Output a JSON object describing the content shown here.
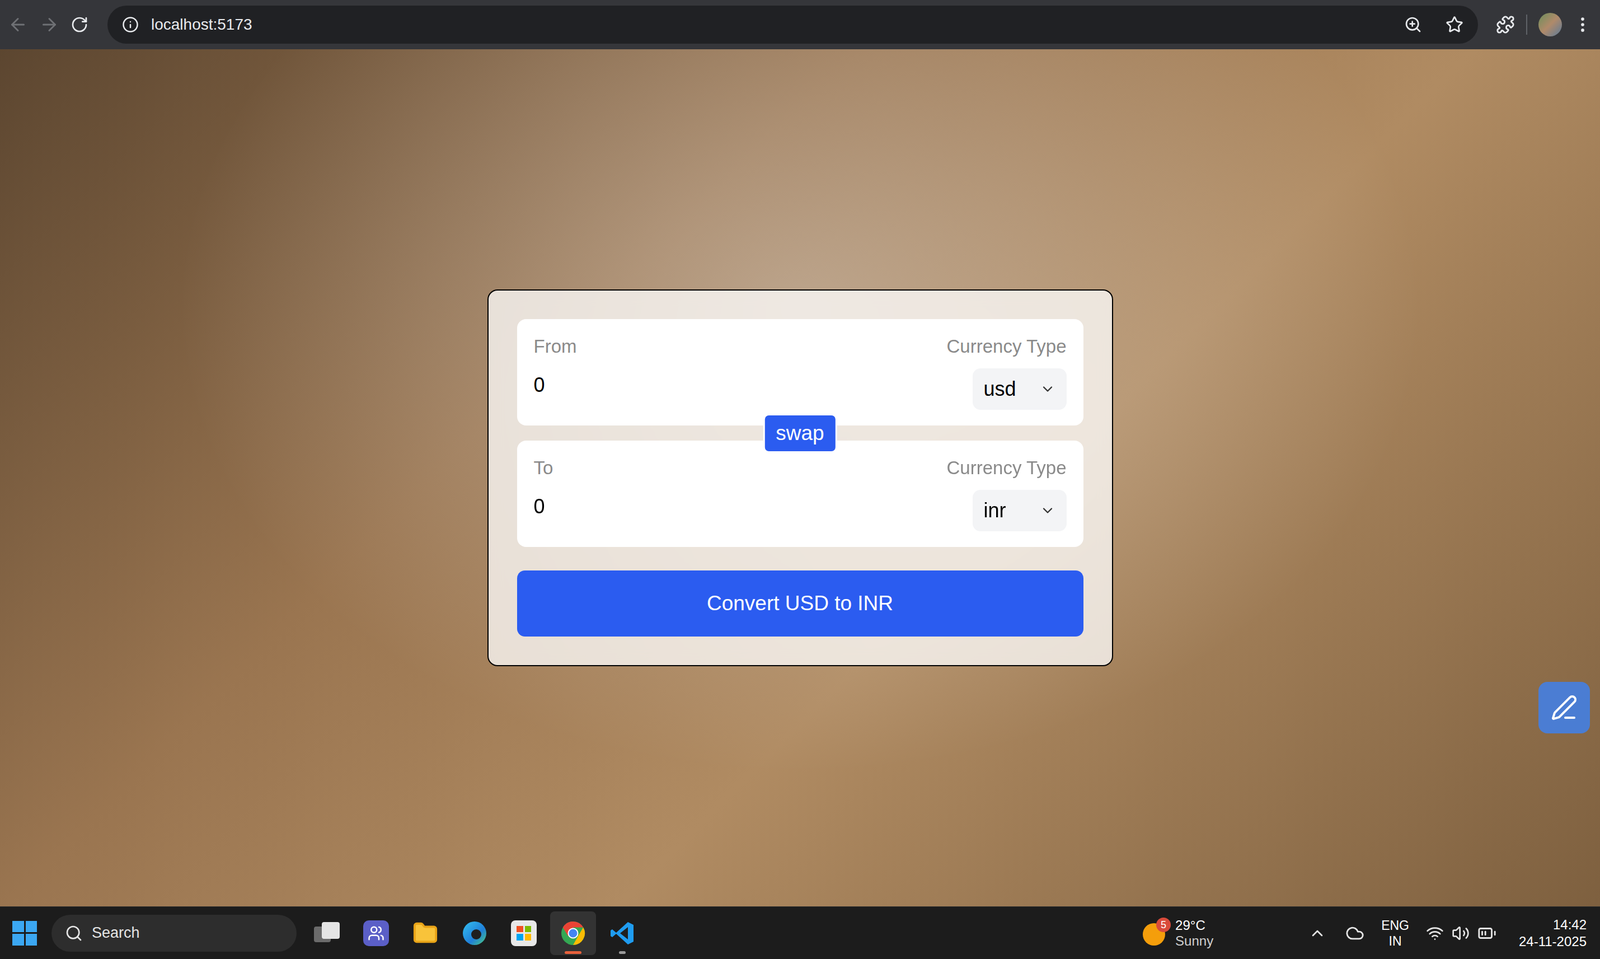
{
  "browser": {
    "url": "localhost:5173",
    "back_enabled": false,
    "forward_enabled": false
  },
  "converter": {
    "from": {
      "label": "From",
      "currency_label": "Currency Type",
      "amount": "0",
      "currency": "usd"
    },
    "to": {
      "label": "To",
      "currency_label": "Currency Type",
      "amount": "0",
      "currency": "inr"
    },
    "swap_button": "swap",
    "convert_button": "Convert USD to INR"
  },
  "taskbar": {
    "search": {
      "placeholder": "Search"
    },
    "apps": [
      {
        "selected": false,
        "running": false
      },
      {
        "selected": false,
        "running": false
      },
      {
        "selected": false,
        "running": false
      },
      {
        "selected": false,
        "running": false
      },
      {
        "selected": false,
        "running": false
      },
      {
        "selected": true,
        "running": true
      },
      {
        "selected": false,
        "running": true
      }
    ],
    "weather": {
      "badge": "5",
      "temperature": "29°C",
      "condition": "Sunny"
    },
    "language": {
      "code": "ENG",
      "region": "IN"
    },
    "clock": {
      "time": "14:42",
      "date": "24-11-2025"
    }
  }
}
